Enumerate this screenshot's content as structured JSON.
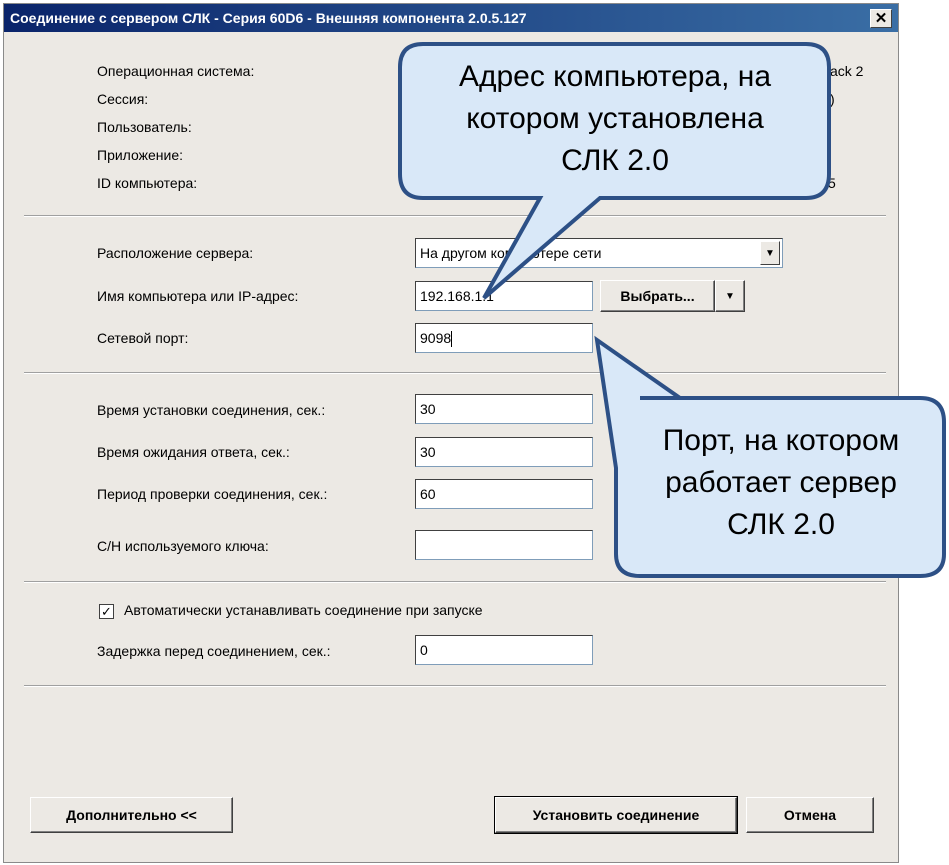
{
  "window": {
    "title": "Соединение с сервером СЛК - Серия 60D6 - Внешняя компонента 2.0.5.127",
    "close_label": "✕"
  },
  "info": {
    "labels": [
      "Операционная система:",
      "Сессия:",
      "Пользователь:",
      "Приложение:",
      "ID компьютера:"
    ],
    "visible_fragments": {
      "os_value_tail": "ack 2",
      "session_value_tail": ")",
      "id_value_tail": "5"
    }
  },
  "server": {
    "location_label": "Расположение сервера:",
    "location_value": "На другом компьютере сети",
    "host_label": "Имя компьютера или IP-адрес:",
    "host_value": "192.168.1.1",
    "choose_button": "Выбрать...",
    "choose_arrow": "▼",
    "combo_arrow": "▼",
    "port_label": "Сетевой порт:",
    "port_value": "9098"
  },
  "timeouts": {
    "connect_label": "Время установки соединения, сек.:",
    "connect_value": "30",
    "response_label": "Время ожидания ответа, сек.:",
    "response_value": "30",
    "check_label": "Период проверки соединения, сек.:",
    "check_value": "60",
    "key_label": "С/Н используемого ключа:",
    "key_value": ""
  },
  "startup": {
    "auto_connect_label": "Автоматически устанавливать соединение при запуске",
    "auto_connect_checked": true,
    "check_mark": "✓",
    "delay_label": "Задержка перед соединением, сек.:",
    "delay_value": "0"
  },
  "buttons": {
    "more": "Дополнительно <<",
    "connect": "Установить соединение",
    "cancel": "Отмена"
  },
  "callouts": {
    "address": [
      "Адрес компьютера, на",
      "котором установлена",
      "СЛК 2.0"
    ],
    "port": [
      "Порт, на котором",
      "работает сервер",
      "СЛК 2.0"
    ],
    "fill_color": "#d9e8f8",
    "stroke_color": "#2d5086"
  }
}
